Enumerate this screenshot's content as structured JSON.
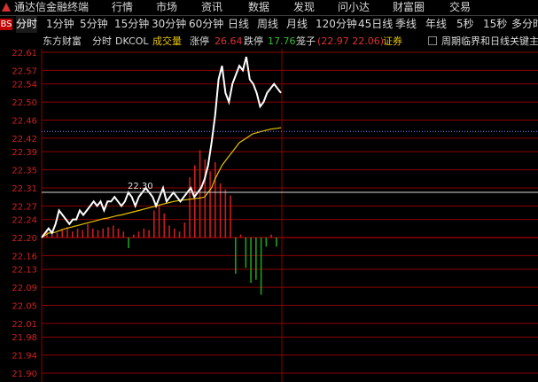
{
  "menubar": {
    "app_name": "通达信金融终端",
    "items": [
      "行情",
      "市场",
      "资讯",
      "数据",
      "发现",
      "问小达",
      "财富圈",
      "交易"
    ]
  },
  "periodbar": {
    "left_mark": "BS",
    "tabs": [
      "分时",
      "1分钟",
      "5分钟",
      "15分钟",
      "30分钟",
      "60分钟",
      "日线",
      "周线",
      "月线",
      "120分钟",
      "45日线",
      "季线",
      "年线",
      "5秒",
      "15秒",
      "多分时"
    ],
    "active": "分时"
  },
  "infobar": {
    "source": "东方财富",
    "mode": "分时",
    "indicator": "DKCOL",
    "volume_label": "成交量",
    "limit_up_label": "涨停",
    "limit_up_value": "26.64",
    "limit_down_label": "跌停",
    "limit_down_value": "17.76",
    "cage_label": "笼子",
    "cage_value": "(22.97 22.06)",
    "securities_label": "证券",
    "checkbox_label": "周期临界和日线关键主"
  },
  "chart_data": {
    "type": "line",
    "y_ticks": [
      "22.61",
      "22.57",
      "22.54",
      "22.50",
      "22.46",
      "22.42",
      "22.39",
      "22.35",
      "22.31",
      "22.27",
      "22.24",
      "22.20",
      "22.16",
      "22.13",
      "22.09",
      "22.05",
      "22.01",
      "21.98",
      "21.94",
      "21.90"
    ],
    "ylim": [
      21.9,
      22.61
    ],
    "prev_close": 22.2,
    "highlight_label": "22.30",
    "highlight_value": 22.3,
    "dotted_line_value": 22.435,
    "price": [
      22.2,
      22.21,
      22.22,
      22.21,
      22.23,
      22.26,
      22.25,
      22.24,
      22.23,
      22.24,
      22.24,
      22.26,
      22.25,
      22.26,
      22.27,
      22.28,
      22.27,
      22.28,
      22.26,
      22.28,
      22.28,
      22.29,
      22.28,
      22.27,
      22.28,
      22.3,
      22.29,
      22.27,
      22.29,
      22.3,
      22.31,
      22.3,
      22.29,
      22.27,
      22.29,
      22.31,
      22.28,
      22.29,
      22.3,
      22.29,
      22.28,
      22.29,
      22.3,
      22.31,
      22.29,
      22.3,
      22.31,
      22.33,
      22.36,
      22.41,
      22.47,
      22.55,
      22.58,
      22.52,
      22.5,
      22.54,
      22.56,
      22.58,
      22.57,
      22.6,
      22.55,
      22.54,
      22.52,
      22.49,
      22.5,
      22.52,
      22.53,
      22.54,
      22.53,
      22.52
    ],
    "avg": [
      22.2,
      22.205,
      22.21,
      22.21,
      22.212,
      22.215,
      22.218,
      22.22,
      22.222,
      22.224,
      22.226,
      22.228,
      22.23,
      22.232,
      22.234,
      22.236,
      22.238,
      22.24,
      22.242,
      22.243,
      22.245,
      22.247,
      22.249,
      22.25,
      22.252,
      22.254,
      22.256,
      22.258,
      22.26,
      22.262,
      22.264,
      22.266,
      22.268,
      22.27,
      22.272,
      22.274,
      22.276,
      22.278,
      22.28,
      22.281,
      22.282,
      22.283,
      22.284,
      22.285,
      22.286,
      22.287,
      22.288,
      22.29,
      22.3,
      22.31,
      22.33,
      22.345,
      22.36,
      22.37,
      22.38,
      22.39,
      22.4,
      22.41,
      22.415,
      22.42,
      22.425,
      22.43,
      22.432,
      22.434,
      22.436,
      22.438,
      22.44,
      22.441,
      22.442,
      22.443
    ],
    "volume_bars": [
      {
        "v": 0.2,
        "c": "up"
      },
      {
        "v": 0.1,
        "c": "up"
      },
      {
        "v": 0.15,
        "c": "up"
      },
      {
        "v": 0.25,
        "c": "up"
      },
      {
        "v": 0.35,
        "c": "up"
      },
      {
        "v": 0.2,
        "c": "up"
      },
      {
        "v": 0.3,
        "c": "up"
      },
      {
        "v": 0.25,
        "c": "up"
      },
      {
        "v": 0.45,
        "c": "up"
      },
      {
        "v": 0.3,
        "c": "up"
      },
      {
        "v": 0.25,
        "c": "up"
      },
      {
        "v": 0.3,
        "c": "up"
      },
      {
        "v": 0.35,
        "c": "up"
      },
      {
        "v": 0.4,
        "c": "up"
      },
      {
        "v": 0.3,
        "c": "up"
      },
      {
        "v": 0.2,
        "c": "up"
      },
      {
        "v": 0.35,
        "c": "down"
      },
      {
        "v": 0.1,
        "c": "up"
      },
      {
        "v": 0.2,
        "c": "up"
      },
      {
        "v": 0.3,
        "c": "up"
      },
      {
        "v": 0.25,
        "c": "up"
      },
      {
        "v": 0.9,
        "c": "up"
      },
      {
        "v": 1.1,
        "c": "up"
      },
      {
        "v": 0.8,
        "c": "up"
      },
      {
        "v": 0.4,
        "c": "up"
      },
      {
        "v": 0.3,
        "c": "up"
      },
      {
        "v": 0.2,
        "c": "up"
      },
      {
        "v": 0.5,
        "c": "up"
      },
      {
        "v": 2.0,
        "c": "up"
      },
      {
        "v": 2.4,
        "c": "up"
      },
      {
        "v": 2.9,
        "c": "up"
      },
      {
        "v": 2.6,
        "c": "up"
      },
      {
        "v": 2.2,
        "c": "up"
      },
      {
        "v": 2.5,
        "c": "up"
      },
      {
        "v": 1.8,
        "c": "up"
      },
      {
        "v": 1.6,
        "c": "up"
      },
      {
        "v": 1.4,
        "c": "up"
      },
      {
        "v": 1.2,
        "c": "down"
      },
      {
        "v": 0.1,
        "c": "up"
      },
      {
        "v": 1.0,
        "c": "down"
      },
      {
        "v": 1.5,
        "c": "down"
      },
      {
        "v": 1.4,
        "c": "down"
      },
      {
        "v": 1.9,
        "c": "down"
      },
      {
        "v": 0.3,
        "c": "down"
      },
      {
        "v": 0.1,
        "c": "up"
      },
      {
        "v": 0.3,
        "c": "down"
      }
    ],
    "colors": {
      "grid": "#8b0000",
      "axis_labels": "#d02020",
      "price_line": "#ffffff",
      "avg_line": "#e6c200",
      "up_bar": "#c81e1e",
      "down_bar": "#1ea01e",
      "highlight_line": "#d8d8d8",
      "dotted_line": "#8080ff"
    }
  }
}
